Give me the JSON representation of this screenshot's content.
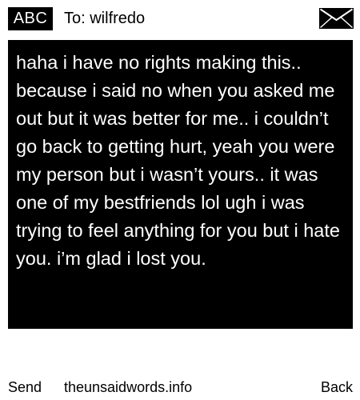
{
  "header": {
    "mode_label": "ABC",
    "recipient": "To: wilfredo",
    "envelope_icon": "envelope-icon"
  },
  "message": {
    "body": "haha i have no rights making this.. because i said no when you asked me out but it was better for me.. i couldn’t go back to getting hurt, yeah you were my person but i wasn’t yours.. it was one of my bestfriends lol ugh i was trying to feel anything for you but i hate you. i’m glad i lost you."
  },
  "footer": {
    "send_label": "Send",
    "site_label": "theunsaidwords.info",
    "back_label": "Back"
  },
  "colors": {
    "background": "#ffffff",
    "panel": "#000000",
    "text_on_panel": "#ffffff"
  }
}
